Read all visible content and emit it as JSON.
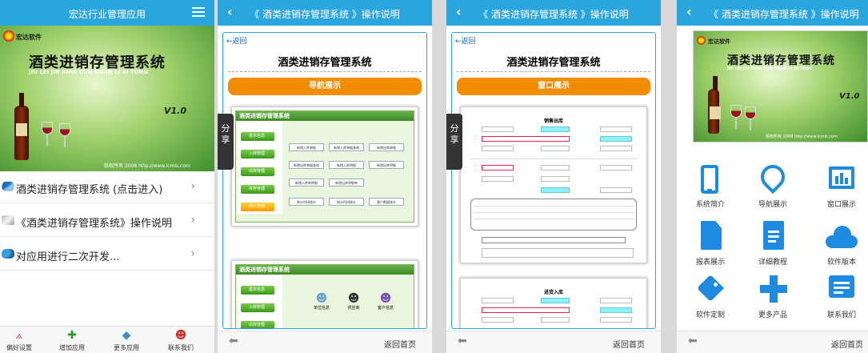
{
  "panel1": {
    "title": "宏达行业管理应用",
    "banner": {
      "logo": "宏达软件",
      "title": "酒类进销存管理系统",
      "pinyin": "JIU LEI JIN XIAO CUN GUAN LI XI TONG",
      "version": "V1.0",
      "copyright": "版权所有 2008 http://www.icmis.com"
    },
    "items": [
      {
        "label": "酒类进销存管理系统 (点击进入)",
        "icon": "wine-icon"
      },
      {
        "label": "《酒类进销存管理系统》操作说明",
        "icon": "docs-icon"
      },
      {
        "label": "对应用进行二次开发...",
        "icon": "puzzle-icon"
      }
    ],
    "nav": [
      {
        "label": "偏好设置",
        "icon": "compass-icon"
      },
      {
        "label": "增加应用",
        "icon": "plus-icon"
      },
      {
        "label": "更多应用",
        "icon": "cube-icon"
      },
      {
        "label": "联系我们",
        "icon": "people-icon"
      }
    ]
  },
  "panel2": {
    "title": "《 酒类进销存管理系统 》操作说明",
    "back": "←返回",
    "doc_title": "酒类进销存管理系统",
    "section": "导航展示",
    "share": "分享",
    "app_title": "酒类进销存管理系统",
    "left_buttons": [
      "基本信息",
      "入库管理",
      "出库管理",
      "库存管理",
      "统计查询"
    ],
    "main_buttons": [
      "新增入库单据",
      "新增入库单据查询",
      "新增出库单据",
      "新增出库单据查询",
      "新增入库明细",
      "新增出库明细",
      "新增入库单明细",
      "新增出库明细单",
      "统计时间统计",
      "统计时间统计",
      "客户数据统计"
    ],
    "app2_items": [
      "单位信息",
      "供应商",
      "客户信息"
    ],
    "home": "返回首页"
  },
  "panel3": {
    "title": "《 酒类进销存管理系统 》操作说明",
    "back": "←返回",
    "doc_title": "酒类进销存管理系统",
    "section": "窗口展示",
    "share": "分享",
    "form1_title": "销售出库",
    "form2_title": "进货入库",
    "home": "返回首页"
  },
  "panel4": {
    "title": "《 酒类进销存管理系统 》操作说明",
    "banner": {
      "logo": "宏达软件",
      "title": "酒类进销存管理系统",
      "pinyin": "JIU LEI JIN XIAO CUN GUAN LI XI TONG",
      "version": "V1.0",
      "copyright": "版权所有 2008 http://www.icmis.com"
    },
    "tiles": [
      {
        "label": "系统简介",
        "icon": "phone-icon"
      },
      {
        "label": "导航展示",
        "icon": "location-pin-icon"
      },
      {
        "label": "窗口展示",
        "icon": "chart-window-icon"
      },
      {
        "label": "报表展示",
        "icon": "document-icon"
      },
      {
        "label": "详细教程",
        "icon": "list-document-icon"
      },
      {
        "label": "软件版本",
        "icon": "cloud-icon"
      },
      {
        "label": "软件定制",
        "icon": "tag-icon"
      },
      {
        "label": "更多产品",
        "icon": "plus-icon"
      },
      {
        "label": "联系我们",
        "icon": "message-icon"
      }
    ],
    "home": "返回首页"
  },
  "colors": {
    "accent": "#2aa6df",
    "orange": "#f28c00",
    "icon_blue": "#1f8be0"
  }
}
